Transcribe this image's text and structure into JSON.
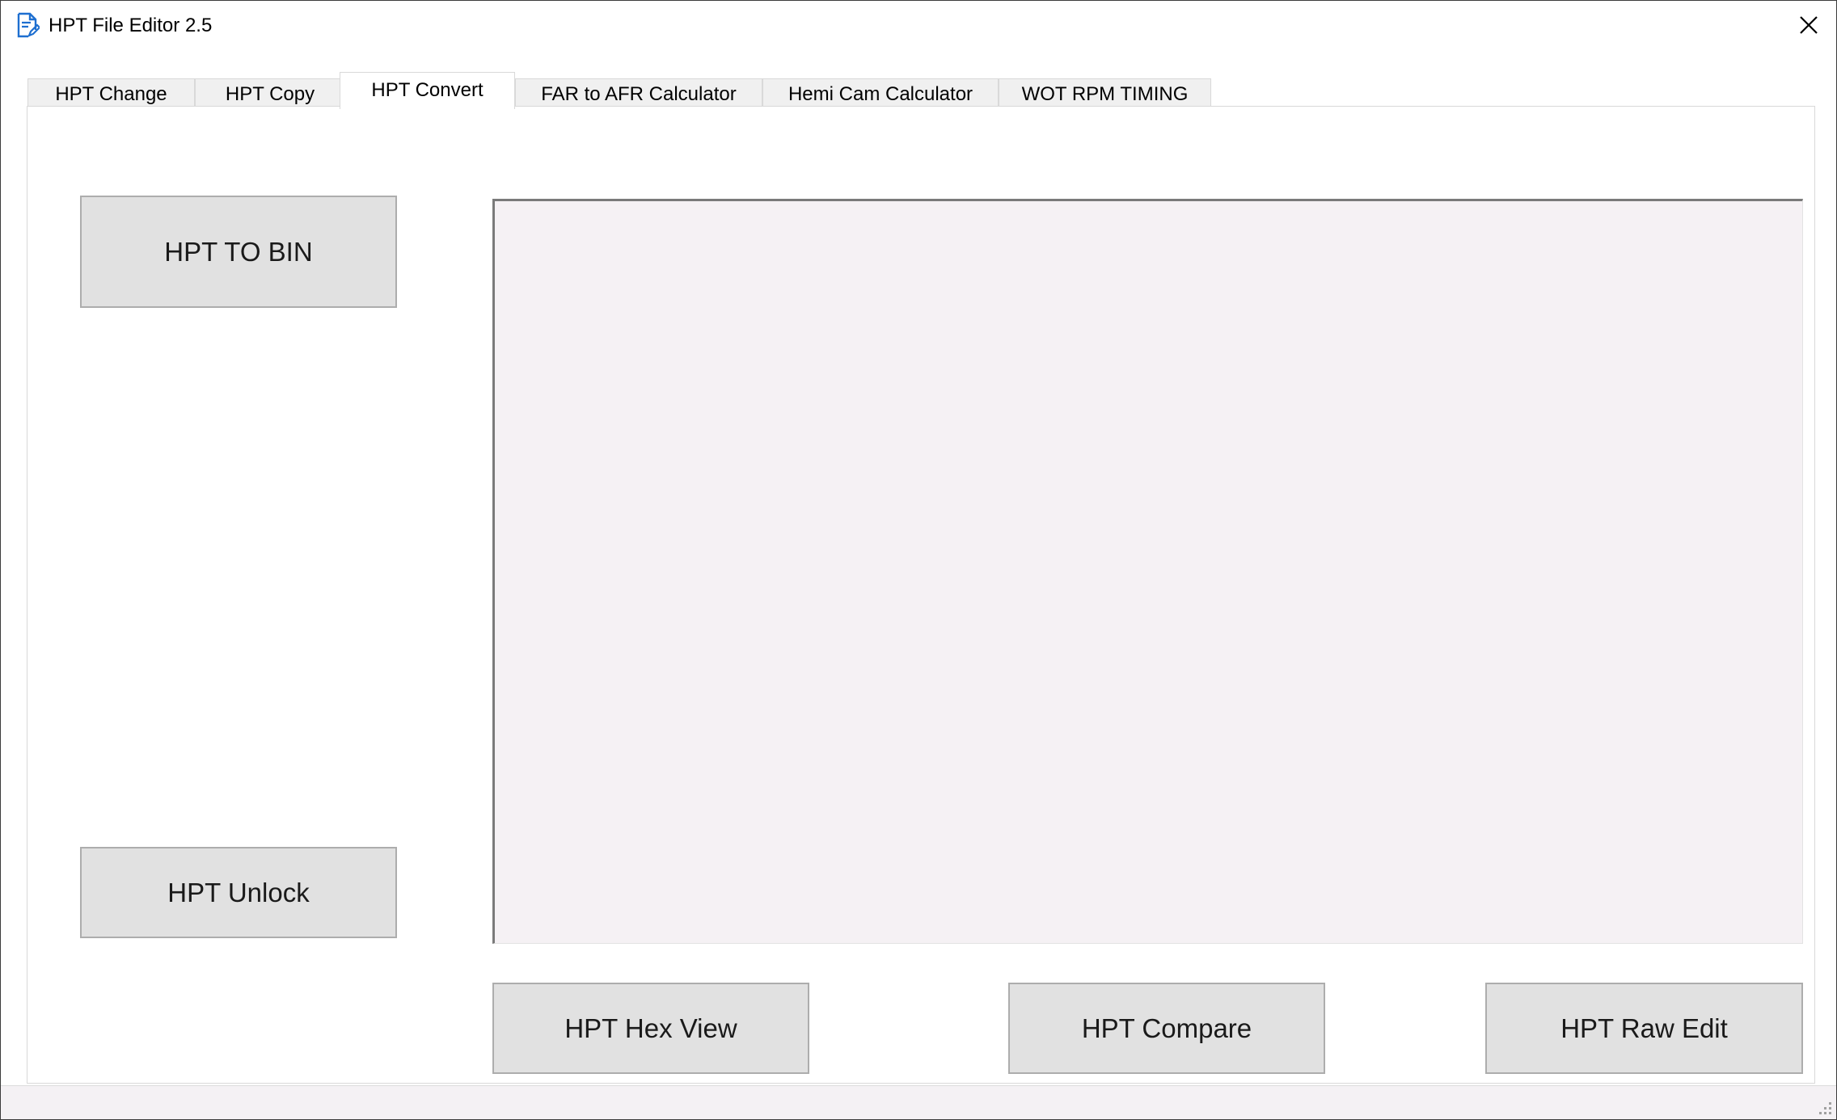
{
  "window": {
    "title": "HPT File Editor 2.5"
  },
  "tabs": [
    {
      "label": "HPT Change",
      "active": false
    },
    {
      "label": "HPT Copy",
      "active": false
    },
    {
      "label": "HPT Convert",
      "active": true
    },
    {
      "label": "FAR to AFR Calculator",
      "active": false
    },
    {
      "label": "Hemi Cam Calculator",
      "active": false
    },
    {
      "label": "WOT RPM TIMING",
      "active": false
    }
  ],
  "buttons": {
    "hpt_to_bin": "HPT TO BIN",
    "hpt_unlock": "HPT Unlock",
    "hpt_hex_view": "HPT Hex View",
    "hpt_compare": "HPT Compare",
    "hpt_raw_edit": "HPT Raw Edit"
  },
  "output_box": {
    "value": ""
  },
  "icons": {
    "app": "document-edit-icon",
    "close": "close-icon",
    "resize": "resize-grip-icon"
  },
  "colors": {
    "icon_blue": "#1e6fd0",
    "button_face": "#e1e1e1",
    "textarea_bg": "#f5f1f4"
  }
}
